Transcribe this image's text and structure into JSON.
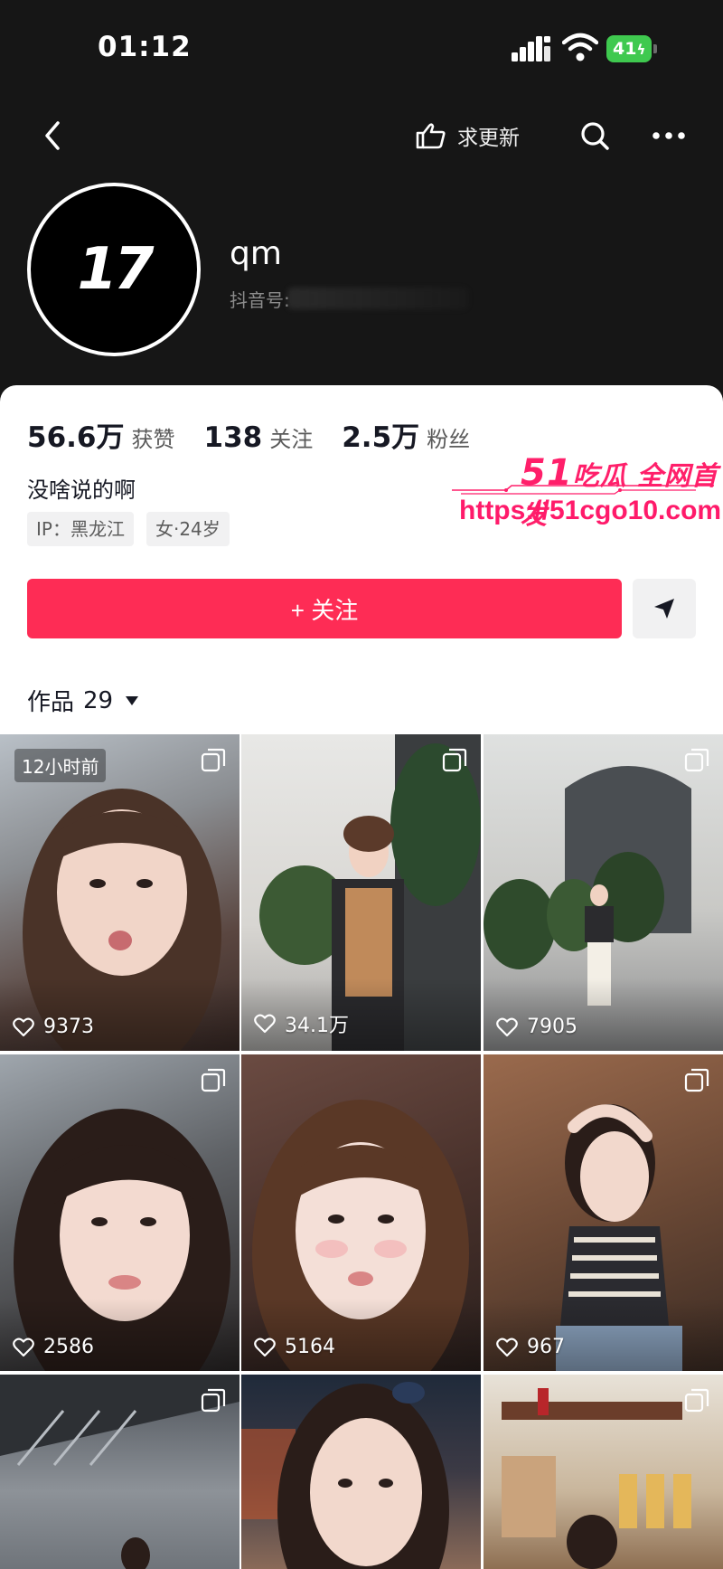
{
  "status_bar": {
    "time": "01:12",
    "battery": "41"
  },
  "nav": {
    "request_update": "求更新"
  },
  "profile": {
    "avatar_text": "17",
    "name": "qm",
    "douyin_id_label": "抖音号:",
    "stats": [
      {
        "num": "56.6万",
        "label": "获赞"
      },
      {
        "num": "138",
        "label": "关注"
      },
      {
        "num": "2.5万",
        "label": "粉丝"
      }
    ],
    "bio": "没啥说的啊",
    "tags": [
      "IP：黑龙江",
      "女·24岁"
    ]
  },
  "watermark": {
    "num": "51",
    "text": "吃瓜 全网首发",
    "url": "https://51cgo10.com"
  },
  "actions": {
    "follow": "+ 关注"
  },
  "works": {
    "label": "作品",
    "count": "29"
  },
  "grid": {
    "items": [
      {
        "time": "12小时前",
        "likes": "9373"
      },
      {
        "likes": "34.1万"
      },
      {
        "likes": "7905"
      },
      {
        "likes": "2586"
      },
      {
        "likes": "5164"
      },
      {
        "likes": "967"
      },
      {
        "likes": ""
      },
      {
        "likes": ""
      },
      {
        "likes": ""
      }
    ]
  },
  "colors": {
    "accent": "#fe2c55",
    "watermark": "#ff1f6a",
    "battery": "#3fc94f"
  }
}
